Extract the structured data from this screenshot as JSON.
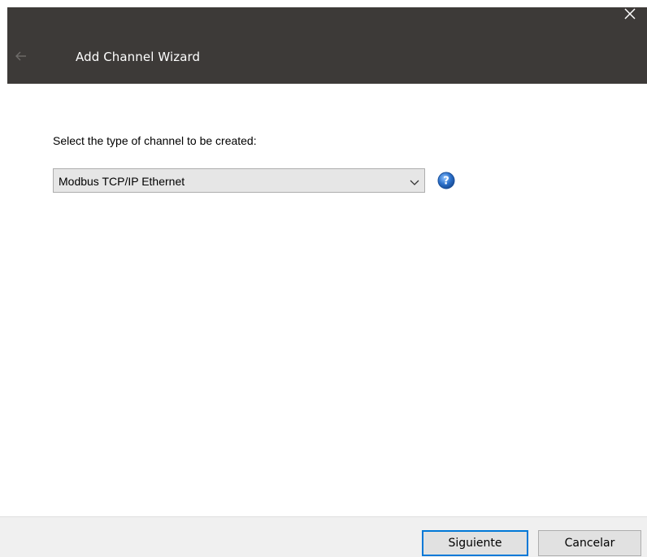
{
  "window": {
    "title": "Add Channel Wizard",
    "back_icon": "arrow-left-icon",
    "close_icon": "close-x-icon"
  },
  "content": {
    "prompt": "Select the type of channel to be created:",
    "channel_type_select": {
      "selected": "Modbus TCP/IP Ethernet",
      "icon": "chevron-down-icon"
    },
    "help_icon": "help-question-icon"
  },
  "footer": {
    "next_label": "Siguiente",
    "cancel_label": "Cancelar"
  },
  "colors": {
    "header_bg": "#3d3a38",
    "accent_border": "#0078d7",
    "help_blue": "#2a6fc9"
  }
}
